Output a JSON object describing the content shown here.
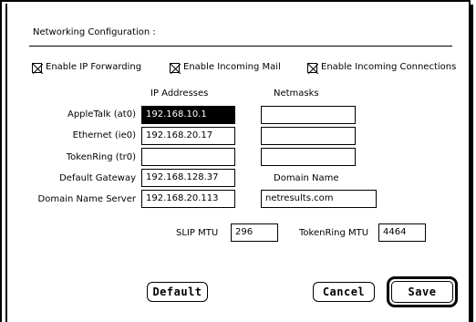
{
  "panel": {
    "title": "Networking Configuration :"
  },
  "checkboxes": [
    {
      "label": "Enable IP Forwarding",
      "checked": true
    },
    {
      "label": "Enable Incoming Mail",
      "checked": true
    },
    {
      "label": "Enable Incoming Connections",
      "checked": true
    }
  ],
  "columns": {
    "ip": "IP Addresses",
    "netmask": "Netmasks",
    "domain": "Domain Name"
  },
  "rows": [
    {
      "label": "AppleTalk (at0)",
      "ip": "192.168.10.1",
      "netmask": ""
    },
    {
      "label": "Ethernet (ie0)",
      "ip": "192.168.20.17",
      "netmask": ""
    },
    {
      "label": "TokenRing (tr0)",
      "ip": "",
      "netmask": ""
    },
    {
      "label": "Default Gateway",
      "ip": "192.168.128.37"
    },
    {
      "label": "Domain Name Server",
      "ip": "192.168.20.113",
      "domain": "netresults.com"
    }
  ],
  "mtu": {
    "slip_label": "SLIP MTU",
    "slip_value": "296",
    "token_label": "TokenRing MTU",
    "token_value": "4464"
  },
  "buttons": {
    "default": "Default",
    "cancel": "Cancel",
    "save": "Save"
  }
}
